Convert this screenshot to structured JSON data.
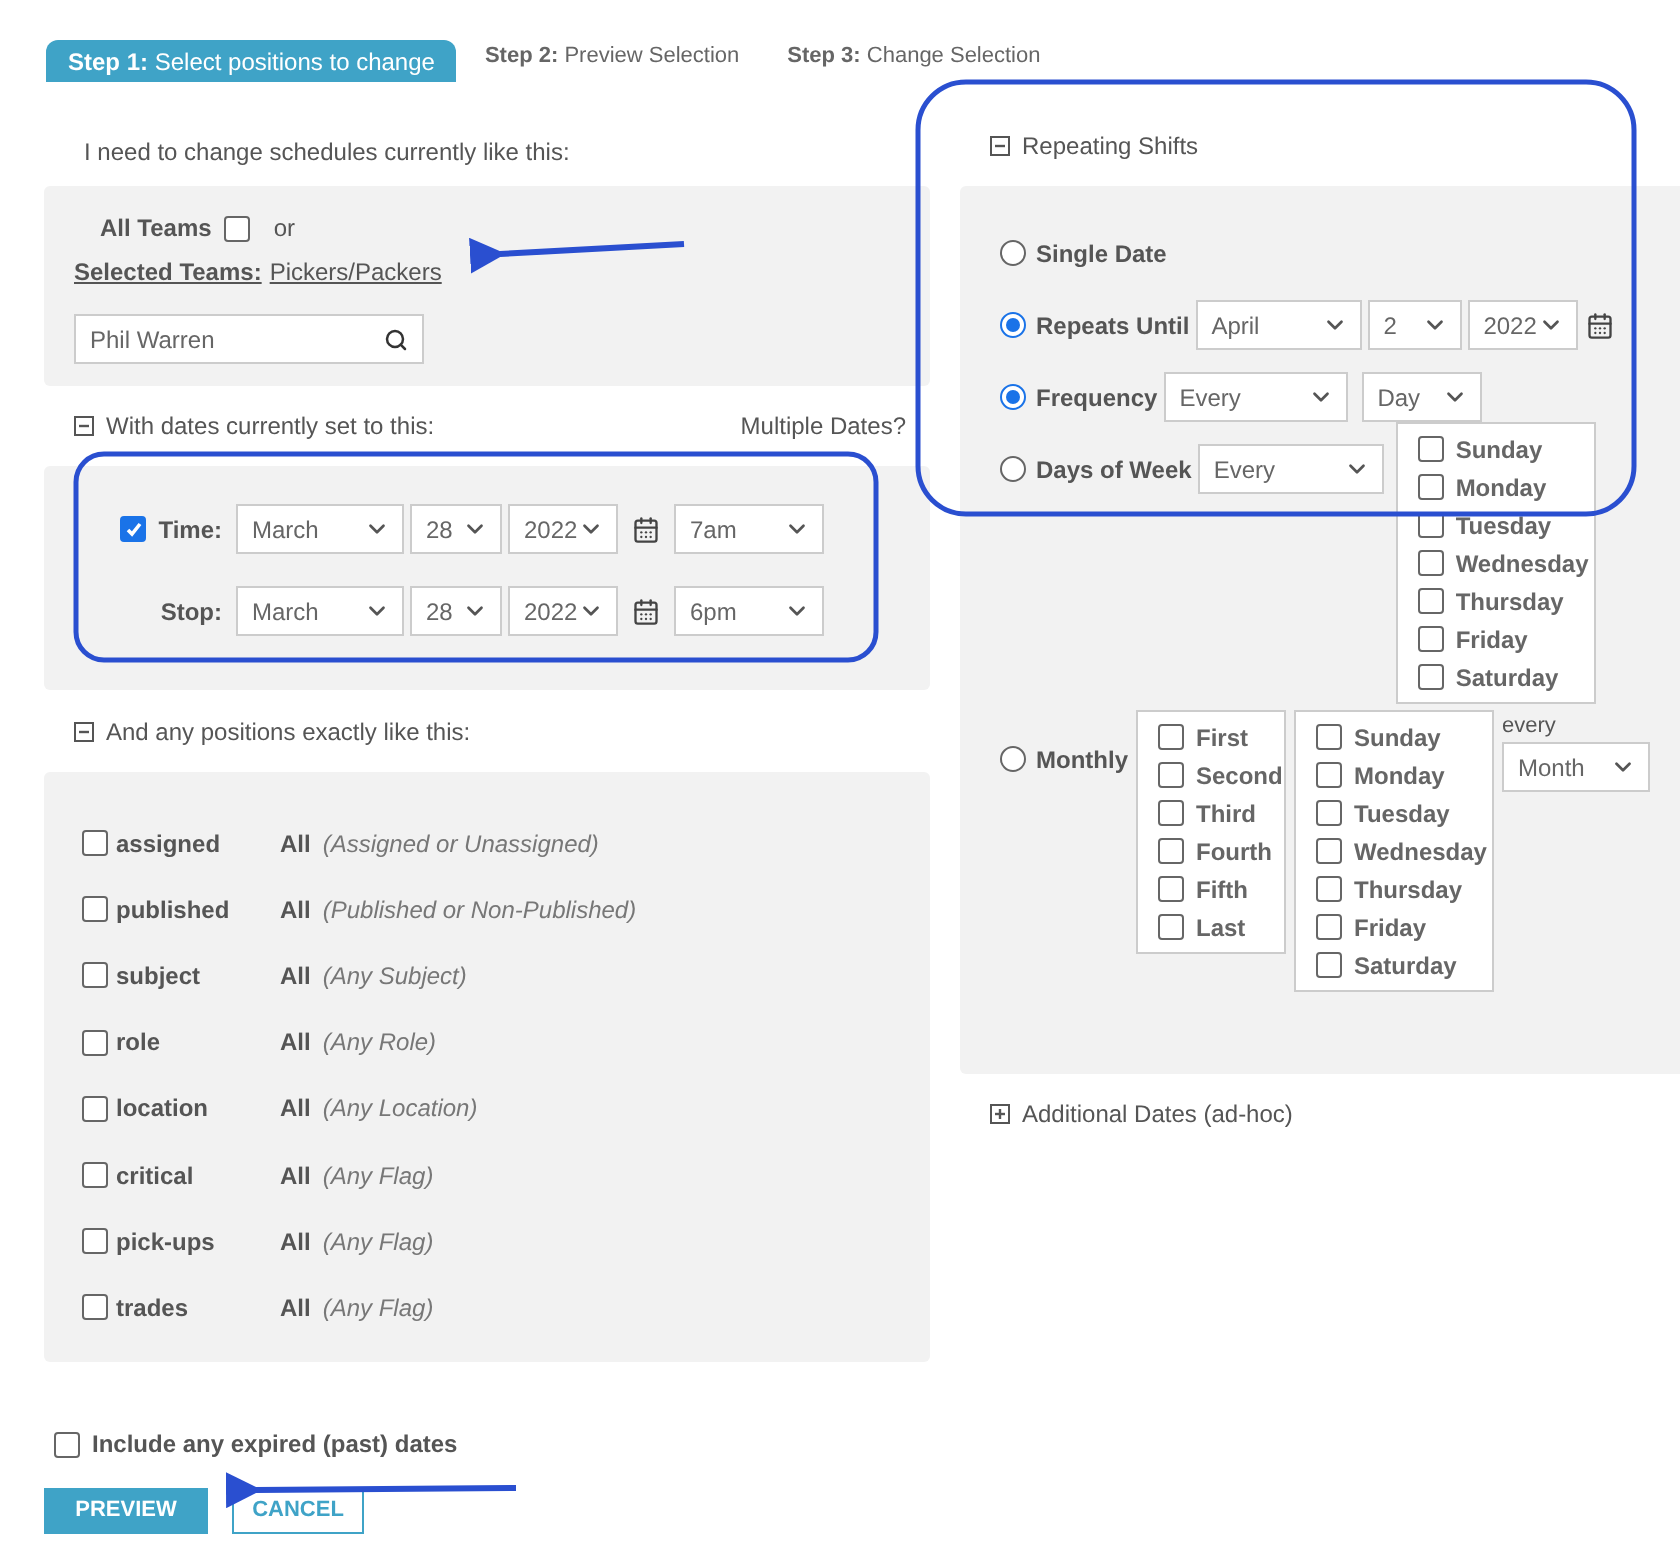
{
  "tabs": [
    {
      "step": "Step 1:",
      "label": "Select positions to change",
      "selected": true
    },
    {
      "step": "Step 2:",
      "label": "Preview Selection",
      "selected": false
    },
    {
      "step": "Step 3:",
      "label": "Change Selection",
      "selected": false
    }
  ],
  "intro": "I need to change schedules currently like this:",
  "teams": {
    "all_label": "All Teams",
    "all_checked": false,
    "or": "or",
    "selected_label": "Selected Teams:",
    "selected_value": "Pickers/Packers",
    "search": {
      "value": "Phil Warren"
    }
  },
  "dates": {
    "title": "With dates currently set to this:",
    "expanded": true,
    "link": "Multiple Dates?",
    "rows": [
      {
        "label": "Time:",
        "checked": true,
        "month": "March",
        "day": "28",
        "year": "2022",
        "time": "7am"
      },
      {
        "label": "Stop:",
        "month": "March",
        "day": "28",
        "year": "2022",
        "time": "6pm"
      }
    ]
  },
  "positions": {
    "title": "And any positions exactly like this:",
    "expanded": true,
    "filters": [
      {
        "name": "assigned",
        "checked": false,
        "value": "All",
        "hint": "(Assigned or Unassigned)"
      },
      {
        "name": "published",
        "checked": false,
        "value": "All",
        "hint": "(Published or Non-Published)"
      },
      {
        "name": "subject",
        "checked": false,
        "value": "All",
        "hint": "(Any Subject)"
      },
      {
        "name": "role",
        "checked": false,
        "value": "All",
        "hint": "(Any Role)"
      },
      {
        "name": "location",
        "checked": false,
        "value": "All",
        "hint": "(Any Location)"
      },
      {
        "name": "critical",
        "checked": false,
        "value": "All",
        "hint": "(Any Flag)"
      },
      {
        "name": "pick-ups",
        "checked": false,
        "value": "All",
        "hint": "(Any Flag)"
      },
      {
        "name": "trades",
        "checked": false,
        "value": "All",
        "hint": "(Any Flag)"
      }
    ]
  },
  "include_expired": {
    "label": "Include any expired (past) dates",
    "checked": false
  },
  "buttons": [
    {
      "label": "PREVIEW",
      "kind": "primary"
    },
    {
      "label": "CANCEL",
      "kind": "secondary"
    }
  ],
  "repeating": {
    "title": "Repeating Shifts",
    "expanded": true,
    "options": [
      {
        "kind": "single",
        "label": "Single Date",
        "selected": false
      },
      {
        "kind": "until",
        "label": "Repeats Until",
        "selected": true,
        "selects": [
          "April",
          "2",
          "2022"
        ]
      },
      {
        "kind": "frequency",
        "label": "Frequency",
        "selected": true,
        "selects": [
          "Every",
          "Day"
        ]
      },
      {
        "kind": "weekdays",
        "label": "Days of Week",
        "selected": false,
        "selects": [
          "Every"
        ],
        "lists": [
          [
            {
              "label": "Sunday",
              "checked": false
            },
            {
              "label": "Monday",
              "checked": false
            },
            {
              "label": "Tuesday",
              "checked": false
            },
            {
              "label": "Wednesday",
              "checked": false
            },
            {
              "label": "Thursday",
              "checked": false
            },
            {
              "label": "Friday",
              "checked": false
            },
            {
              "label": "Saturday",
              "checked": false
            }
          ]
        ]
      },
      {
        "kind": "monthly",
        "label": "Monthly",
        "selected": false,
        "lists": [
          [
            {
              "label": "First",
              "checked": false
            },
            {
              "label": "Second",
              "checked": false
            },
            {
              "label": "Third",
              "checked": false
            },
            {
              "label": "Fourth",
              "checked": false
            },
            {
              "label": "Fifth",
              "checked": false
            },
            {
              "label": "Last",
              "checked": false
            }
          ],
          [
            {
              "label": "Sunday",
              "checked": false
            },
            {
              "label": "Monday",
              "checked": false
            },
            {
              "label": "Tuesday",
              "checked": false
            },
            {
              "label": "Wednesday",
              "checked": false
            },
            {
              "label": "Thursday",
              "checked": false
            },
            {
              "label": "Friday",
              "checked": false
            },
            {
              "label": "Saturday",
              "checked": false
            }
          ]
        ],
        "every_label": "every",
        "every_select": "Month"
      }
    ]
  },
  "additional": {
    "title": "Additional Dates (ad-hoc)",
    "expanded": false
  }
}
